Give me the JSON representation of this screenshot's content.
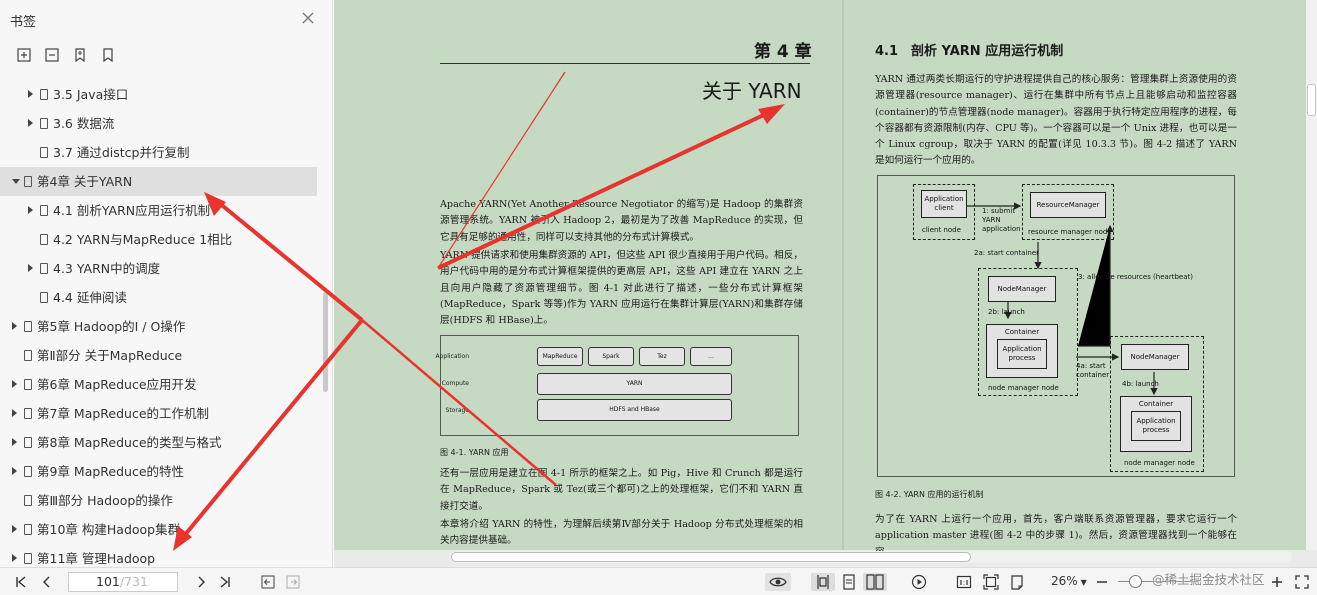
{
  "sidebar": {
    "title": "书签",
    "toc": [
      {
        "label": "3.5 Java接口",
        "arrow": "closed",
        "indent": 2
      },
      {
        "label": "3.6 数据流",
        "arrow": "closed",
        "indent": 2
      },
      {
        "label": "3.7 通过distcp并行复制",
        "arrow": "none",
        "indent": 2
      },
      {
        "label": "第4章 关于YARN",
        "arrow": "open",
        "indent": 1,
        "selected": true
      },
      {
        "label": "4.1 剖析YARN应用运行机制",
        "arrow": "closed",
        "indent": 2
      },
      {
        "label": "4.2 YARN与MapReduce 1相比",
        "arrow": "none",
        "indent": 2
      },
      {
        "label": "4.3 YARN中的调度",
        "arrow": "closed",
        "indent": 2
      },
      {
        "label": "4.4 延伸阅读",
        "arrow": "none",
        "indent": 2
      },
      {
        "label": "第5章 Hadoop的I / O操作",
        "arrow": "closed",
        "indent": 1
      },
      {
        "label": "第Ⅱ部分 关于MapReduce",
        "arrow": "none",
        "indent": 1
      },
      {
        "label": "第6章 MapReduce应用开发",
        "arrow": "closed",
        "indent": 1
      },
      {
        "label": "第7章 MapReduce的工作机制",
        "arrow": "closed",
        "indent": 1
      },
      {
        "label": "第8章 MapReduce的类型与格式",
        "arrow": "closed",
        "indent": 1
      },
      {
        "label": "第9章 MapReduce的特性",
        "arrow": "closed",
        "indent": 1
      },
      {
        "label": "第Ⅲ部分 Hadoop的操作",
        "arrow": "none",
        "indent": 1
      },
      {
        "label": "第10章 构建Hadoop集群",
        "arrow": "closed",
        "indent": 1
      },
      {
        "label": "第11章 管理Hadoop",
        "arrow": "closed",
        "indent": 1
      }
    ]
  },
  "page_left": {
    "chapter_number": "第 4 章",
    "chapter_title": "关于 YARN",
    "para1": "Apache YARN(Yet Another Resource Negotiator 的缩写)是 Hadoop 的集群资源管理系统。YARN 被引入 Hadoop 2，最初是为了改善 MapReduce 的实现，但它具有足够的通用性，同样可以支持其他的分布式计算模式。",
    "para2": "YARN 提供请求和使用集群资源的 API，但这些 API 很少直接用于用户代码。相反，用户代码中用的是分布式计算框架提供的更高层 API，这些 API 建立在 YARN 之上且向用户隐藏了资源管理细节。图 4-1 对此进行了描述，一些分布式计算框架(MapReduce，Spark 等等)作为 YARN 应用运行在集群计算层(YARN)和集群存储层(HDFS 和 HBase)上。",
    "fig1": {
      "row_labels": [
        "Application",
        "Compute",
        "Storage"
      ],
      "apps": [
        "MapReduce",
        "Spark",
        "Tez",
        "..."
      ],
      "compute": "YARN",
      "storage": "HDFS and HBase"
    },
    "fig1_caption": "图 4-1. YARN 应用",
    "para3": "还有一层应用是建立在图 4-1 所示的框架之上。如 Pig，Hive 和 Crunch 都是运行在 MapReduce，Spark 或 Tez(或三个都可)之上的处理框架，它们不和 YARN 直接打交道。",
    "para4": "本章将介绍 YARN 的特性，为理解后续第Ⅳ部分关于 Hadoop 分布式处理框架的相关内容提供基础。"
  },
  "page_right": {
    "section_title": "4.1　剖析 YARN 应用运行机制",
    "para1": "YARN 通过两类长期运行的守护进程提供自己的核心服务：管理集群上资源使用的资源管理器(resource manager)、运行在集群中所有节点上且能够启动和监控容器(container)的节点管理器(node manager)。容器用于执行特定应用程序的进程，每个容器都有资源限制(内存、CPU 等)。一个容器可以是一个 Unix 进程，也可以是一个 Linux cgroup，取决于 YARN 的配置(详见 10.3.3 节)。图 4-2 描述了 YARN 是如何运行一个应用的。",
    "fig2": {
      "app_client": "Application client",
      "client_node": "client node",
      "step1": "1: submit YARN application",
      "resource_manager": "ResourceManager",
      "rm_node": "resource manager node",
      "step2a": "2a: start container",
      "step3": "3: allocate resources (heartbeat)",
      "node_manager": "NodeManager",
      "step2b": "2b: launch",
      "container": "Container",
      "app_process": "Application process",
      "nm_node": "node manager node",
      "step4a": "4a: start container",
      "step4b": "4b: launch"
    },
    "fig2_caption": "图 4-2. YARN 应用的运行机制",
    "para2": "为了在 YARN 上运行一个应用，首先，客户端联系资源管理器，要求它运行一个 application master 进程(图 4-2 中的步骤 1)。然后，资源管理器找到一个能够在容"
  },
  "bottom_bar": {
    "current_page": "101",
    "total_pages": "/731",
    "zoom": "26%"
  },
  "watermark": "@稀土掘金技术社区",
  "colors": {
    "page_bg": "#c6dac3",
    "annotation_red": "#e8332f"
  }
}
